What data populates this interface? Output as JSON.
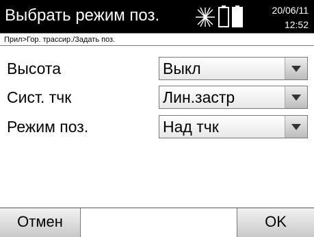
{
  "header": {
    "title": "Выбрать режим поз.",
    "date": "20/06/11",
    "time": "12:52",
    "icons": [
      "laser-beam-icon",
      "battery-icon",
      "battery-icon"
    ]
  },
  "breadcrumb": "Прил>Гор. трассир./Задать поз.",
  "fields": [
    {
      "label": "Высота",
      "value": "Выкл"
    },
    {
      "label": "Сист. тчк",
      "value": "Лин.застр"
    },
    {
      "label": "Режим поз.",
      "value": "Над тчк"
    }
  ],
  "softkeys": {
    "left": "Отмен",
    "middle": "",
    "right": "OK"
  },
  "colors": {
    "titlebar": "#000000",
    "background": "#ffffff"
  }
}
